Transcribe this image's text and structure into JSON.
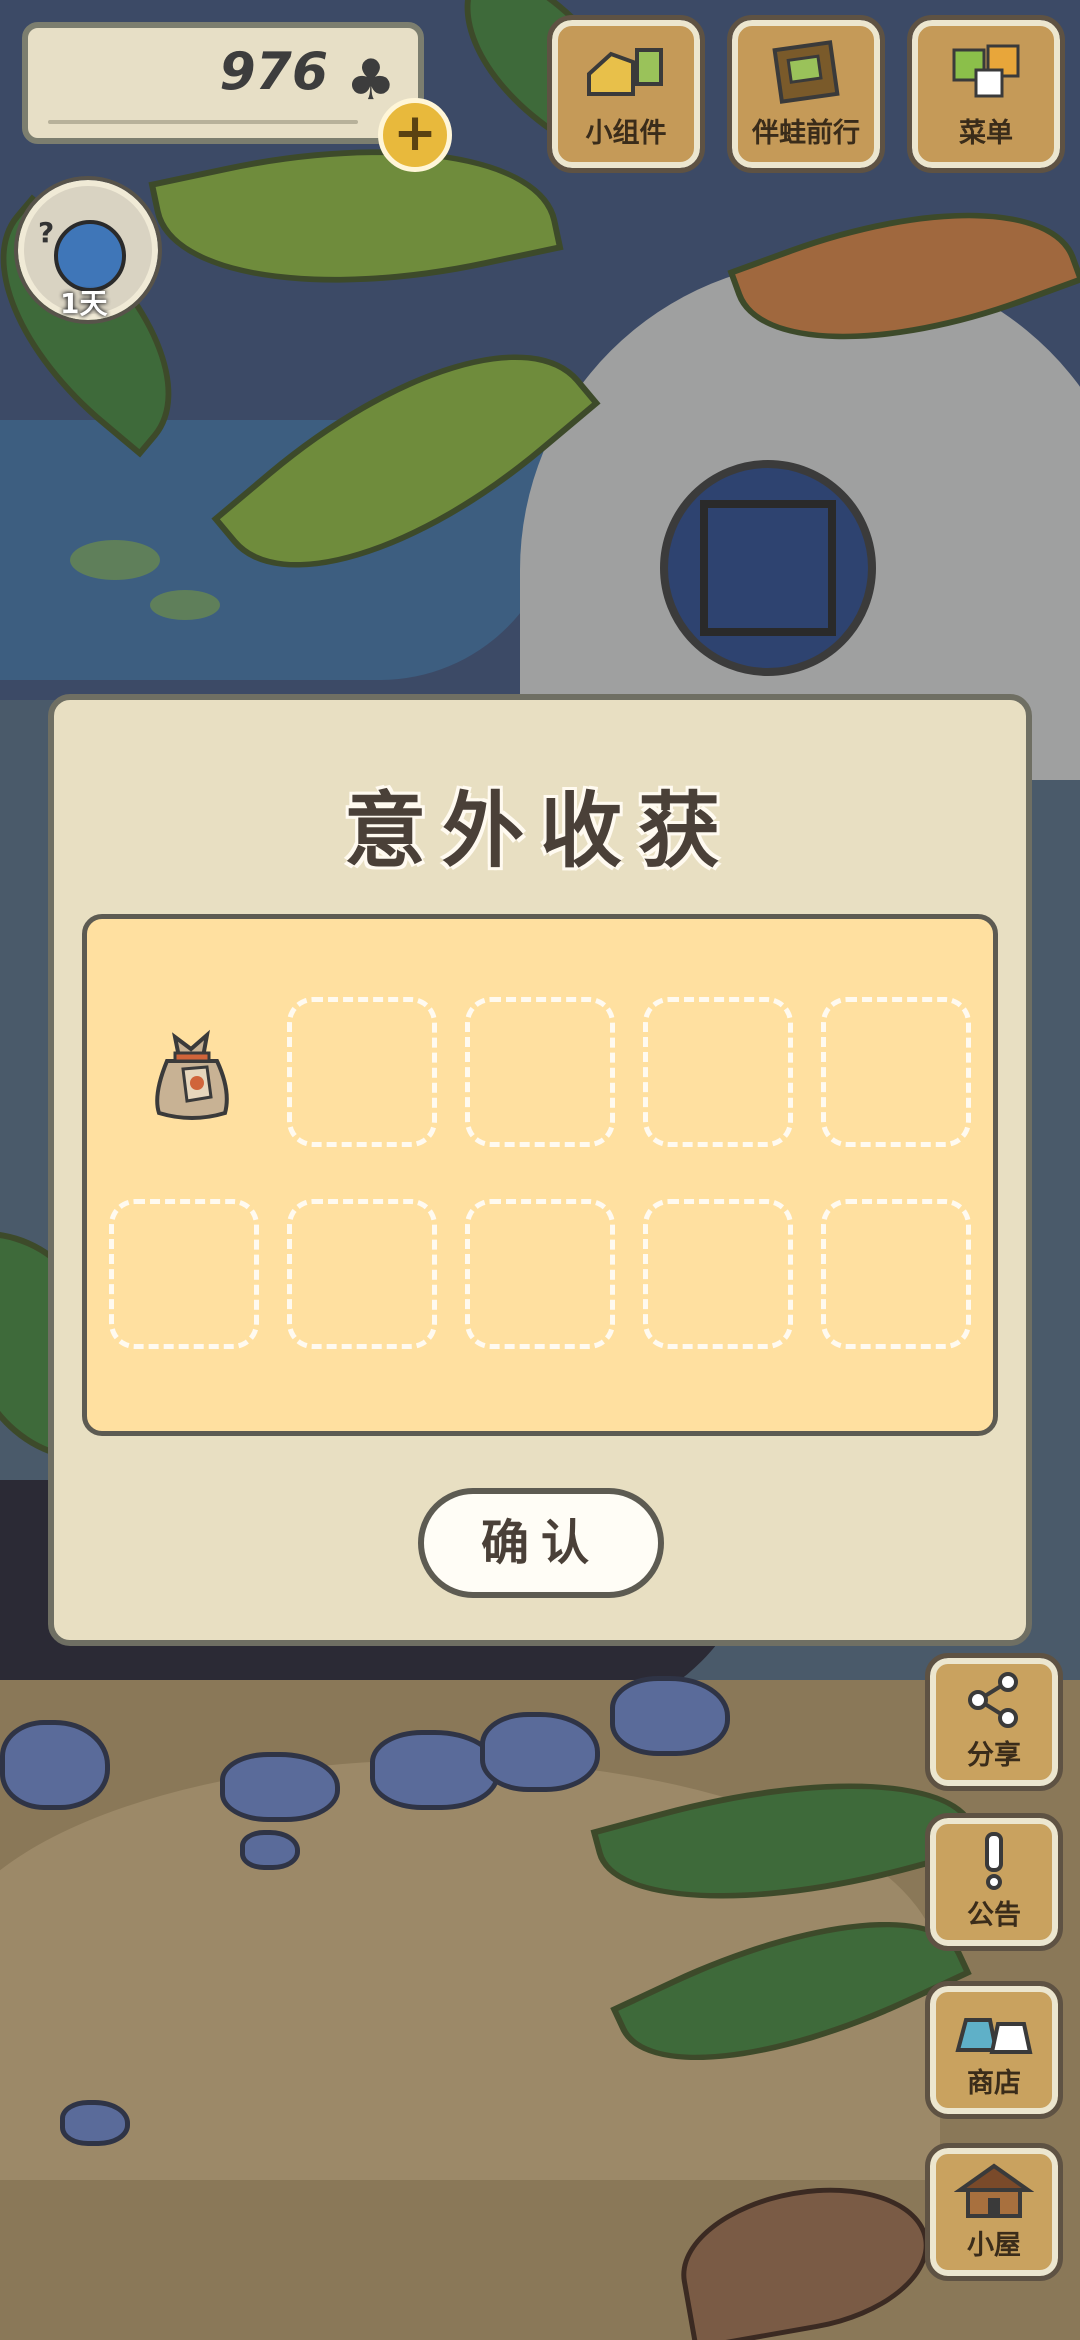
{
  "hud": {
    "clover_count": "976",
    "plus_symbol": "+",
    "traveler_days": "1天"
  },
  "top_buttons": [
    {
      "label": "小组件",
      "icon": "widget-icon"
    },
    {
      "label": "伴蛙前行",
      "icon": "journal-icon"
    },
    {
      "label": "菜单",
      "icon": "menu-icon"
    }
  ],
  "side_buttons": [
    {
      "label": "分享",
      "icon": "share-icon"
    },
    {
      "label": "公告",
      "icon": "notice-icon"
    },
    {
      "label": "商店",
      "icon": "shop-icon"
    },
    {
      "label": "小屋",
      "icon": "house-icon"
    }
  ],
  "dialog": {
    "title": "意外收获",
    "confirm_label": "确认",
    "items": [
      {
        "slot": 1,
        "content": "seed-bag-icon"
      },
      {
        "slot": 2,
        "content": ""
      },
      {
        "slot": 3,
        "content": ""
      },
      {
        "slot": 4,
        "content": ""
      },
      {
        "slot": 5,
        "content": ""
      },
      {
        "slot": 6,
        "content": ""
      },
      {
        "slot": 7,
        "content": ""
      },
      {
        "slot": 8,
        "content": ""
      },
      {
        "slot": 9,
        "content": ""
      },
      {
        "slot": 10,
        "content": ""
      }
    ]
  },
  "colors": {
    "dialog_bg": "#e8dfc2",
    "panel_bg": "#ffe0a0",
    "button_wood": "#c59a58"
  }
}
